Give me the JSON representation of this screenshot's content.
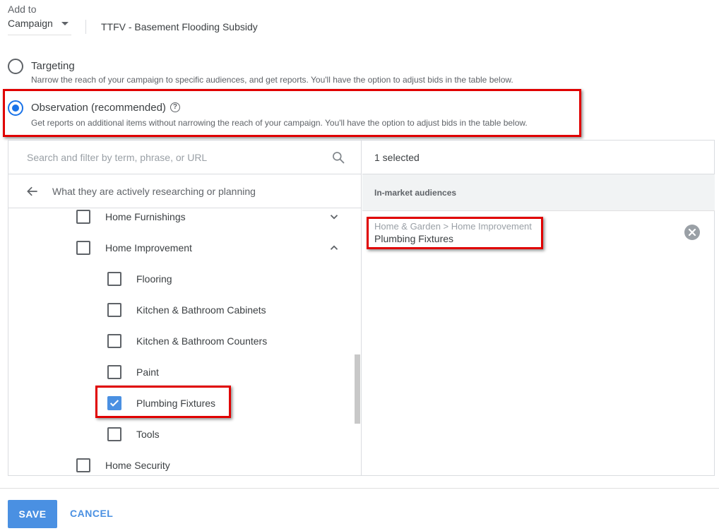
{
  "header": {
    "add_to_label": "Add to",
    "add_to_value": "Campaign",
    "campaign_name": "TTFV - Basement Flooding Subsidy"
  },
  "options": {
    "targeting": {
      "title": "Targeting",
      "description": "Narrow the reach of your campaign to specific audiences, and get reports. You'll have the option to adjust bids in the table below.",
      "selected": false
    },
    "observation": {
      "title": "Observation (recommended)",
      "help_glyph": "?",
      "description": "Get reports on additional items without narrowing the reach of your campaign. You'll have the option to adjust bids in the table below.",
      "selected": true
    }
  },
  "browser": {
    "search_placeholder": "Search and filter by term, phrase, or URL",
    "breadcrumb": "What they are actively researching or planning",
    "items": [
      {
        "label": "Home Furnishings",
        "checked": false,
        "expand": "chevron-down"
      },
      {
        "label": "Home Improvement",
        "checked": false,
        "expand": "chevron-up"
      },
      {
        "label": "Flooring",
        "checked": false
      },
      {
        "label": "Kitchen & Bathroom Cabinets",
        "checked": false
      },
      {
        "label": "Kitchen & Bathroom Counters",
        "checked": false
      },
      {
        "label": "Paint",
        "checked": false
      },
      {
        "label": "Plumbing Fixtures",
        "checked": true
      },
      {
        "label": "Tools",
        "checked": false
      },
      {
        "label": "Home Security",
        "checked": false
      }
    ]
  },
  "selection": {
    "count_text": "1 selected",
    "group_title": "In-market audiences",
    "items": [
      {
        "path": "Home & Garden > Home Improvement",
        "name": "Plumbing Fixtures"
      }
    ]
  },
  "footer": {
    "save_label": "SAVE",
    "cancel_label": "CANCEL"
  },
  "colors": {
    "accent": "#4a90e2",
    "radio_selected": "#1a73e8",
    "highlight_box": "#e00000"
  }
}
